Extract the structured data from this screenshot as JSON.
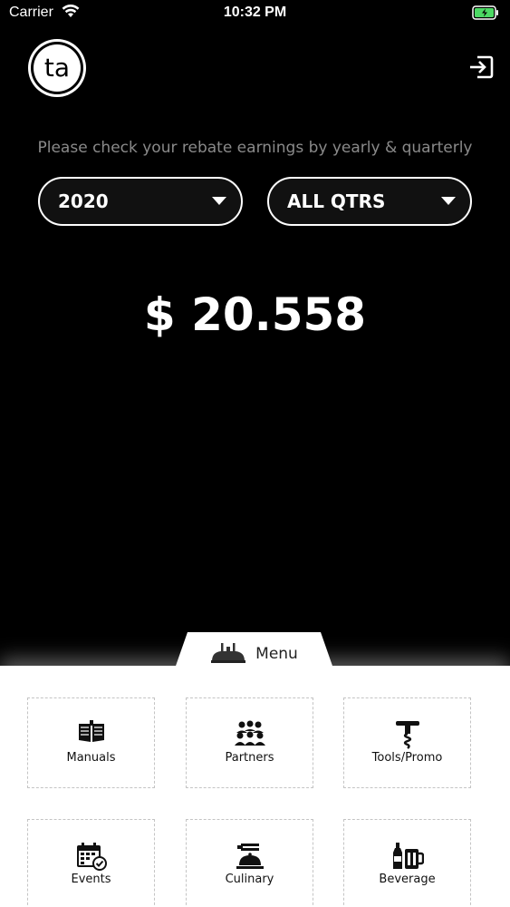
{
  "status_bar": {
    "carrier": "Carrier",
    "time": "10:32 PM"
  },
  "header": {
    "logo_text": "ta",
    "logout_icon": "logout-icon"
  },
  "rebate": {
    "subtitle": "Please check your rebate earnings by yearly & quarterly",
    "year_value": "2020",
    "quarter_value": "ALL QTRS",
    "amount": "$ 20.558"
  },
  "menu": {
    "tab_label": "Menu",
    "tab_icon": "menu-restaurant-icon",
    "tiles": [
      {
        "label": "Manuals",
        "icon": "manuals-icon"
      },
      {
        "label": "Partners",
        "icon": "partners-icon"
      },
      {
        "label": "Tools/Promo",
        "icon": "corkscrew-icon"
      },
      {
        "label": "Events",
        "icon": "calendar-icon"
      },
      {
        "label": "Culinary",
        "icon": "cloche-icon"
      },
      {
        "label": "Beverage",
        "icon": "beverage-icon"
      }
    ]
  },
  "colors": {
    "background": "#000000",
    "accent_white": "#ffffff",
    "subtitle_gray": "#8a8a8a",
    "battery_green": "#4cd964"
  }
}
